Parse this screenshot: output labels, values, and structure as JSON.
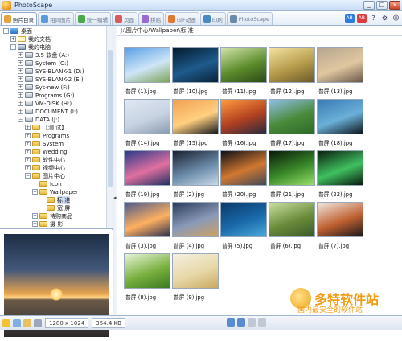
{
  "window": {
    "title": "PhotoScape"
  },
  "tabs": [
    {
      "label": "照片目录",
      "active": true
    },
    {
      "label": "相同图片",
      "active": false
    },
    {
      "label": "统一编辑",
      "active": false
    },
    {
      "label": "页面",
      "active": false
    },
    {
      "label": "拼贴",
      "active": false
    },
    {
      "label": "GIF动画",
      "active": false
    },
    {
      "label": "印刷",
      "active": false
    },
    {
      "label": "PhotoScape",
      "active": false
    }
  ],
  "toolbar_right": {
    "badge_a": "AB",
    "badge_b": "AB",
    "help": "?"
  },
  "tree": {
    "nodes": [
      {
        "label": "桌面",
        "icon": "desktop",
        "expander": "−"
      },
      {
        "label": "我的文档",
        "icon": "documents",
        "expander": "+"
      },
      {
        "label": "我的电脑",
        "icon": "computer",
        "expander": "−"
      },
      {
        "label": "3.5 软盘 (A:)",
        "icon": "drive",
        "expander": "+"
      },
      {
        "label": "System (C:)",
        "icon": "drive",
        "expander": "+"
      },
      {
        "label": "SYS-BLANK-1 (D:)",
        "icon": "drive",
        "expander": "+"
      },
      {
        "label": "SYS-BLANK-2 (E:)",
        "icon": "drive",
        "expander": "+"
      },
      {
        "label": "Sys-new (F:)",
        "icon": "drive",
        "expander": "+"
      },
      {
        "label": "Programs (G:)",
        "icon": "drive",
        "expander": "+"
      },
      {
        "label": "VM-DISK (H:)",
        "icon": "drive",
        "expander": "+"
      },
      {
        "label": "DOCUMENT (I:)",
        "icon": "drive",
        "expander": "+"
      },
      {
        "label": "DATA (J:)",
        "icon": "drive",
        "expander": "−"
      },
      {
        "label": "【测 试】",
        "icon": "folder",
        "expander": "+"
      },
      {
        "label": "Programs",
        "icon": "folder",
        "expander": "+"
      },
      {
        "label": "System",
        "icon": "folder",
        "expander": "+"
      },
      {
        "label": "Wedding",
        "icon": "folder",
        "expander": "+"
      },
      {
        "label": "软件中心",
        "icon": "folder",
        "expander": "+"
      },
      {
        "label": "视频中心",
        "icon": "folder",
        "expander": "+"
      },
      {
        "label": "图片中心",
        "icon": "folder",
        "expander": "−"
      },
      {
        "label": "Icon",
        "icon": "folder",
        "expander": ""
      },
      {
        "label": "Wallpaper",
        "icon": "folder",
        "expander": "−"
      },
      {
        "label": "标 准",
        "icon": "folder",
        "expander": "",
        "selected": true
      },
      {
        "label": "宽 屏",
        "icon": "folder",
        "expander": ""
      },
      {
        "label": "待购商品",
        "icon": "folder",
        "expander": "+"
      },
      {
        "label": "摄 影",
        "icon": "folder",
        "expander": "+"
      }
    ]
  },
  "path": "J:\\图片中心\\Wallpaper\\标 准",
  "thumbnails": [
    {
      "label": "普屏 (1).jpg",
      "colors": [
        "#5aa0e6",
        "#cfe6f7",
        "#7ea35a"
      ]
    },
    {
      "label": "普屏 (10).jpg",
      "colors": [
        "#041a2e",
        "#1e5b8c",
        "#0a2238"
      ]
    },
    {
      "label": "普屏 (11).jpg",
      "colors": [
        "#cfe3a8",
        "#5c8c2c",
        "#2c4a16"
      ]
    },
    {
      "label": "普屏 (12).jpg",
      "colors": [
        "#f3e2a0",
        "#b59a4a",
        "#6b5a2a"
      ]
    },
    {
      "label": "普屏 (13).jpg",
      "colors": [
        "#b6a58f",
        "#e0c7a0",
        "#6a5a4a"
      ]
    },
    {
      "label": "普屏 (14).jpg",
      "colors": [
        "#dfe7f2",
        "#c8d3e2",
        "#8a9cb0"
      ]
    },
    {
      "label": "普屏 (15).jpg",
      "colors": [
        "#f0a050",
        "#ffd080",
        "#1a1a20"
      ]
    },
    {
      "label": "普屏 (16).jpg",
      "colors": [
        "#ff9a40",
        "#b04020",
        "#2a2a40"
      ]
    },
    {
      "label": "普屏 (17).jpg",
      "colors": [
        "#8fbfe6",
        "#4a8a3a",
        "#2e6b2a"
      ]
    },
    {
      "label": "普屏 (18).jpg",
      "colors": [
        "#3a7ab4",
        "#6ab0d8",
        "#101820"
      ]
    },
    {
      "label": "普屏 (19).jpg",
      "colors": [
        "#2a3a8a",
        "#e070a0",
        "#203060"
      ]
    },
    {
      "label": "普屏 (2).jpg",
      "colors": [
        "#1a2030",
        "#6a8aa8",
        "#c8d8e8"
      ]
    },
    {
      "label": "普屏 (20).jpg",
      "colors": [
        "#101018",
        "#d07830",
        "#404858"
      ]
    },
    {
      "label": "普屏 (21).jpg",
      "colors": [
        "#0a1a0a",
        "#3a8a2a",
        "#9ae06a"
      ]
    },
    {
      "label": "普屏 (22).jpg",
      "colors": [
        "#0a2010",
        "#40c060",
        "#0a1a10"
      ]
    },
    {
      "label": "普屏 (3).jpg",
      "colors": [
        "#4a5a8a",
        "#ffb060",
        "#2a3050"
      ]
    },
    {
      "label": "普屏 (4).jpg",
      "colors": [
        "#2a3a5a",
        "#8a9ab8",
        "#d0a060"
      ]
    },
    {
      "label": "普屏 (5).jpg",
      "colors": [
        "#0a3a6a",
        "#1a6aaa",
        "#4aaada"
      ]
    },
    {
      "label": "普屏 (6).jpg",
      "colors": [
        "#c8e0a0",
        "#6a8a3a",
        "#3a5a2a"
      ]
    },
    {
      "label": "普屏 (7).jpg",
      "colors": [
        "#f0e8e0",
        "#c06030",
        "#1a1a1a"
      ]
    },
    {
      "label": "普屏 (8).jpg",
      "colors": [
        "#e8f4d8",
        "#7ab040",
        "#3a7a20"
      ]
    },
    {
      "label": "普屏 (9).jpg",
      "colors": [
        "#f4f0e0",
        "#e8d8a8",
        "#c8a860"
      ]
    }
  ],
  "status": {
    "resolution": "1280 x 1024",
    "filesize": "354.4 KB"
  },
  "watermark": {
    "brand": "多特软件站",
    "slogan": "国内最安全的软件站"
  },
  "colors": {
    "accent": "#3a6fb0",
    "tab_bg": "#dde7f3",
    "selection": "#cfe0f7"
  }
}
